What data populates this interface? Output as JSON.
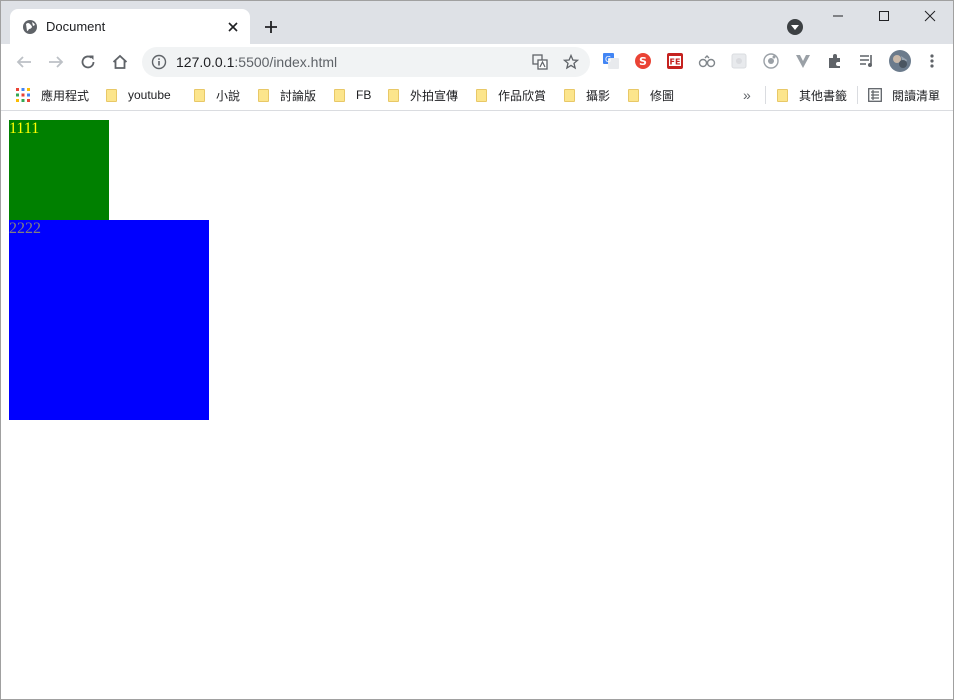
{
  "tab": {
    "title": "Document"
  },
  "omnibox": {
    "url_host": "127.0.0.1",
    "url_rest": ":5500/index.html"
  },
  "bookmarks": {
    "apps": "應用程式",
    "items": [
      "youtube",
      "小說",
      "討論版",
      "FB",
      "外拍宣傳",
      "作品欣賞",
      "攝影",
      "修圖"
    ],
    "overflow": "»",
    "other": "其他書籤",
    "reading_list": "閱讀清單"
  },
  "page": {
    "box1_text": "1111",
    "box2_text": "2222",
    "box1_bg": "#008000",
    "box1_fg": "#ffff00",
    "box2_bg": "#0000ff",
    "box2_fg": "#808080"
  },
  "icons": [
    "globe-icon",
    "close-icon",
    "plus-icon",
    "tab-search-icon",
    "minimize-icon",
    "maximize-icon",
    "window-close-icon",
    "back-icon",
    "forward-icon",
    "reload-icon",
    "home-icon",
    "info-icon",
    "translate-icon",
    "star-icon",
    "google-translate-ext-icon",
    "s-ext-icon",
    "fe-ext-icon",
    "ext-icon",
    "extensions-icon",
    "media-icon",
    "avatar",
    "menu-icon",
    "apps-grid-icon",
    "folder-icon",
    "reading-list-icon"
  ]
}
